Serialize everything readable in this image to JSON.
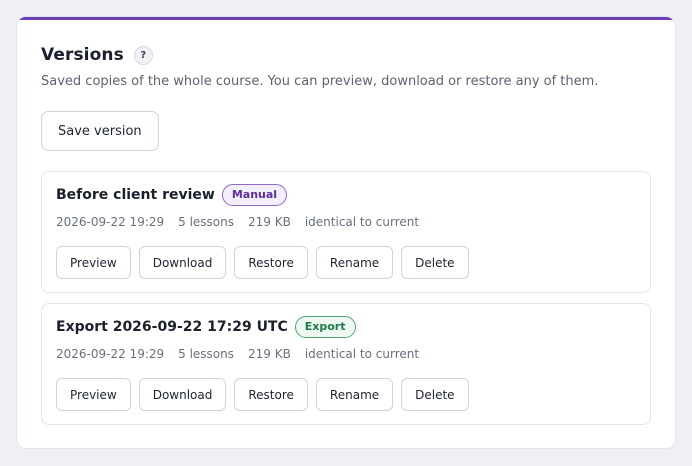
{
  "header": {
    "title": "Versions",
    "help_symbol": "?",
    "subtitle": "Saved copies of the whole course. You can preview, download or restore any of them."
  },
  "toolbar": {
    "save_label": "Save version"
  },
  "versions": [
    {
      "name": "Before client review",
      "badge": "Manual",
      "date": "2026-09-22 19:29",
      "lessons": "5 lessons",
      "size": "219 KB",
      "status": "identical to current",
      "actions": [
        "Preview",
        "Download",
        "Restore",
        "Rename",
        "Delete"
      ]
    },
    {
      "name": "Export 2026-09-22 17:29 UTC",
      "badge": "Export",
      "date": "2026-09-22 19:29",
      "lessons": "5 lessons",
      "size": "219 KB",
      "status": "identical to current",
      "actions": [
        "Preview",
        "Download",
        "Restore",
        "Rename",
        "Delete"
      ]
    }
  ],
  "colors": {
    "accent": "#6b3fb8",
    "manual_badge": "#5b2f9f",
    "export_badge": "#1f7a4a"
  }
}
